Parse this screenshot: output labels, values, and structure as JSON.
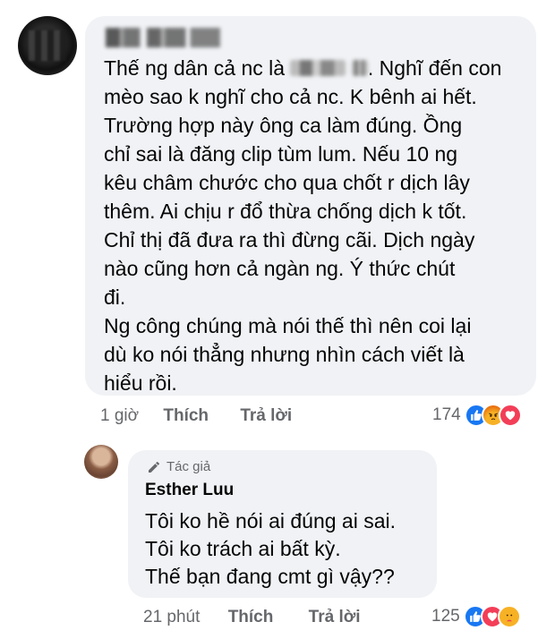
{
  "comment": {
    "text_part1": "Thế ng dân cả nc là ",
    "text_part2": " ",
    "text_part3": ". Nghĩ đến con\nmèo sao k nghĩ cho cả nc. K bênh ai hết.\nTrường hợp này ông ca làm đúng. Ồng\nchỉ sai là đăng clip tùm lum. Nếu 10 ng\nkêu châm chước cho qua chốt r dịch lây\nthêm. Ai chịu r đổ thừa chống dịch k tốt.\nChỉ thị đã đưa ra thì đừng cãi. Dịch ngày\nnào cũng hơn cả ngàn ng. Ý thức chút\nđi.\nNg công chúng mà nói thế thì nên coi lại\ndù ko nói thẳng nhưng nhìn cách viết là\nhiểu rồi.",
    "time": "1 giờ",
    "like_label": "Thích",
    "reply_label": "Trả lời",
    "reaction_count": "174",
    "reactions": [
      "like-icon",
      "angry-icon",
      "love-icon"
    ]
  },
  "reply": {
    "badge": "Tác giả",
    "author": "Esther Luu",
    "text": "Tôi ko hề nói ai đúng ai sai.\nTôi ko trách ai bất kỳ.\nThế bạn đang cmt gì vậy??",
    "time": "21 phút",
    "like_label": "Thích",
    "reply_label": "Trả lời",
    "reaction_count": "125",
    "reactions": [
      "like-icon",
      "love-icon",
      "care-icon"
    ]
  },
  "colors": {
    "bubble": "#f0f2f5",
    "meta": "#65676b",
    "like": "#1877f2",
    "love": "#f33e58",
    "angry": "#e9710f"
  }
}
